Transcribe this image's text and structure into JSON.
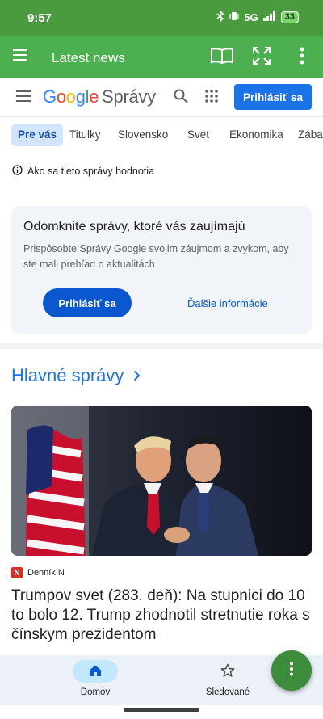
{
  "status": {
    "time": "9:57",
    "network": "5G",
    "battery": "33"
  },
  "appbar": {
    "title": "Latest news",
    "icons": [
      "menu-icon",
      "book-icon",
      "fullscreen-icon",
      "more-vert-icon"
    ]
  },
  "header": {
    "logo_brand": "Google",
    "logo_product": "Správy",
    "signin_label": "Prihlásiť sa",
    "icons": [
      "menu-icon",
      "search-icon",
      "apps-icon"
    ]
  },
  "tabs": [
    {
      "label": "Pre vás",
      "active": true
    },
    {
      "label": "Titulky"
    },
    {
      "label": "Slovensko"
    },
    {
      "label": "Svet"
    },
    {
      "label": "Ekonomika"
    },
    {
      "label": "Zábava"
    }
  ],
  "info": {
    "text": "Ako sa tieto správy hodnotia"
  },
  "promo": {
    "title": "Odomknite správy, ktoré vás zaujímajú",
    "description": "Prispôsobte Správy Google svojim záujmom a zvykom, aby ste mali prehľad o aktualitách",
    "signin_label": "Prihlásiť sa",
    "more_label": "Ďalšie informácie"
  },
  "section": {
    "title": "Hlavné správy"
  },
  "article": {
    "source": "Denník N",
    "source_logo": "N",
    "headline": "Trumpov svet (283. deň): Na stupnici do 10 to bolo 12. Trump zhodnotil stretnutie roka s čínskym prezidentom"
  },
  "bottom_nav": [
    {
      "label": "Domov",
      "active": true,
      "icon": "home-icon"
    },
    {
      "label": "Sledované",
      "active": false,
      "icon": "star-icon"
    }
  ],
  "colors": {
    "appbar": "#4caf50",
    "accent": "#1a73e8",
    "fab": "#3b8d3c"
  }
}
